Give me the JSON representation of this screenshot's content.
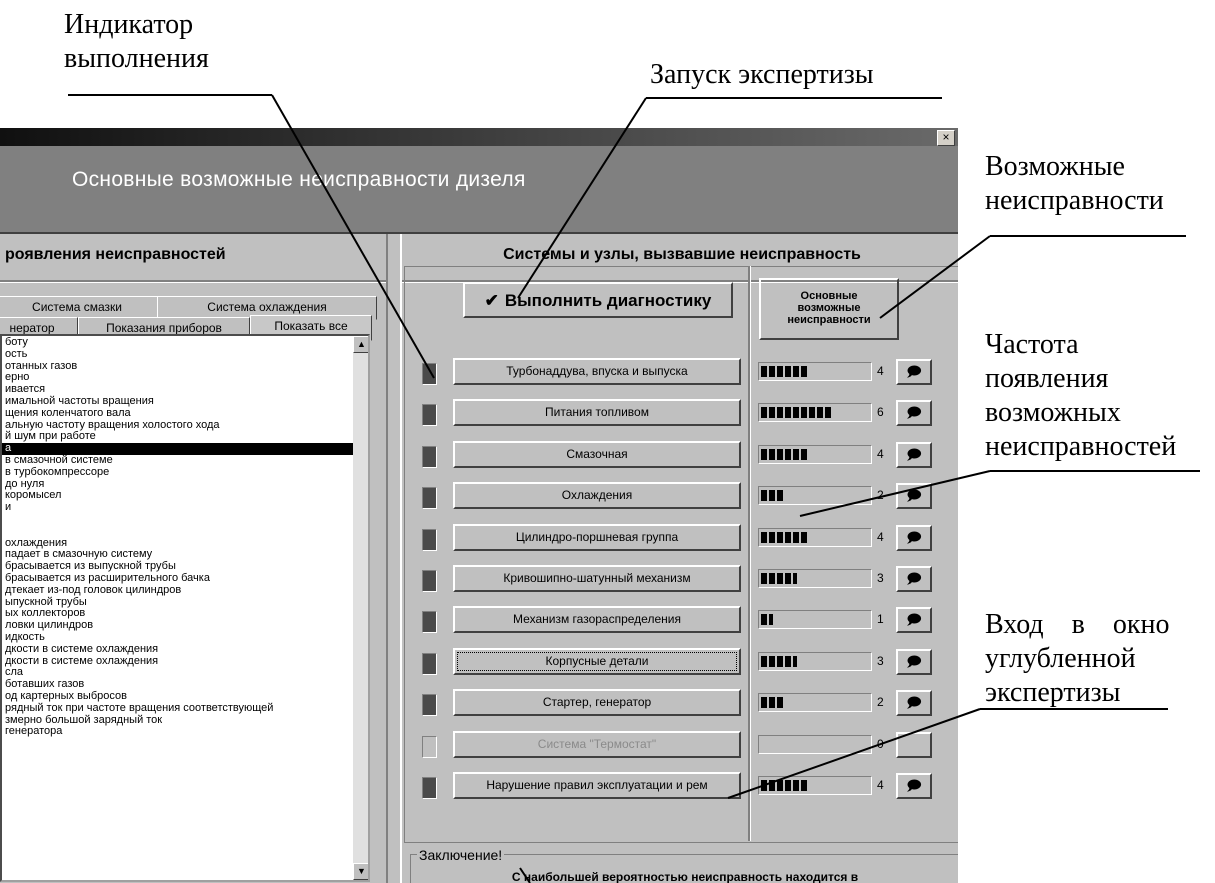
{
  "annotations": {
    "progress_indicator": "Индикатор\nвыполнения",
    "start_expertise": "Запуск экспертизы",
    "possible_faults": "Возможные\nнеисправности",
    "fault_frequency": "Частота\nпоявления\nвозможных\nнеисправностей",
    "deep_expertise_line1": "Вход    в    окно",
    "deep_expertise_line2": "углубленной",
    "deep_expertise_line3": "экспертизы"
  },
  "window": {
    "close_glyph": "×",
    "main_title": "Основные возможные неисправности дизеля"
  },
  "left": {
    "heading": "роявления неисправностей",
    "tabs_row1": [
      "Система смазки",
      "Система охлаждения"
    ],
    "tabs_row2": [
      "нератор",
      "Показания приборов",
      "Показать все"
    ],
    "list": [
      "боту",
      "ость",
      "отанных газов",
      "ерно",
      "ивается",
      "имальной частоты вращения",
      "щения коленчатого вала",
      "альную частоту вращения холостого хода",
      "й шум при работе",
      "а",
      "в смазочной системе",
      "в турбокомпрессоре",
      "до нуля",
      "коромысел",
      "и",
      "",
      "",
      "охлаждения",
      "падает в смазочную систему",
      "брасывается из выпускной трубы",
      "брасывается из расширительного бачка",
      "дтекает из-под головок цилиндров",
      "ыпускной трубы",
      "ых коллекторов",
      "ловки цилиндров",
      "идкость",
      "дкости в системе охлаждения",
      "дкости в системе охлаждения",
      "сла",
      "ботавших газов",
      "од картерных выбросов",
      "рядный ток при частоте вращения соответствующей",
      "змерно большой зарядный ток",
      "генератора"
    ],
    "selected_index": 9
  },
  "right": {
    "heading": "Системы и узлы, вызвавшие неисправность",
    "run_check": "✔",
    "run_button": "Выполнить диагностику",
    "freq_header": "Основные\nвозможные\nнеисправности",
    "systems": [
      {
        "label": "Турбонаддува, впуска и выпуска",
        "count": "4",
        "value": 4,
        "enabled": true
      },
      {
        "label": "Питания топливом",
        "count": "6",
        "value": 6,
        "enabled": true
      },
      {
        "label": "Смазочная",
        "count": "4",
        "value": 4,
        "enabled": true
      },
      {
        "label": "Охлаждения",
        "count": "2",
        "value": 2,
        "enabled": true
      },
      {
        "label": "Цилиндро-поршневая группа",
        "count": "4",
        "value": 4,
        "enabled": true
      },
      {
        "label": "Кривошипно-шатунный механизм",
        "count": "3",
        "value": 3,
        "enabled": true
      },
      {
        "label": "Механизм газораспределения",
        "count": "1",
        "value": 1,
        "enabled": true
      },
      {
        "label": "Корпусные детали",
        "count": "3",
        "value": 3,
        "enabled": true
      },
      {
        "label": "Стартер, генератор",
        "count": "2",
        "value": 2,
        "enabled": true
      },
      {
        "label": "Система \"Термостат\"",
        "count": "0",
        "value": 0,
        "enabled": false
      },
      {
        "label": "Нарушение правил эксплуатации и рем",
        "count": "4",
        "value": 4,
        "enabled": true
      }
    ],
    "speech_glyph": "🗩",
    "conclusion_label": "Заключение!",
    "conclusion_text": "С наибольшей вероятностью неисправность находится в\nсистеме Питания топливом"
  }
}
